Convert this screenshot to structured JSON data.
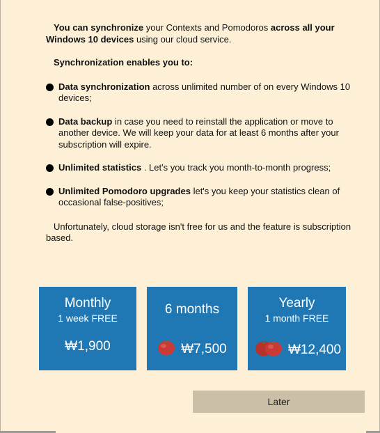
{
  "intro": {
    "bold1": "You can synchronize",
    "rest1": " your Contexts and Pomodoros ",
    "bold2": "across all your Windows 10 devices",
    "rest2": " using our cloud service."
  },
  "enables_heading": "Synchronization enables you to:",
  "bullets": [
    {
      "title": "Data synchronization",
      "desc": " across unlimited number of on every Windows 10 devices;"
    },
    {
      "title": "Data backup",
      "desc": " in case you need to reinstall the application or move to another device. We will keep your data for at least 6 months after your subscription will expire."
    },
    {
      "title": "Unlimited statistics",
      "desc": " . Let's you track you month-to-month progress;"
    },
    {
      "title": "Unlimited Pomodoro upgrades",
      "desc": " let's you keep your statistics clean of occasional false-positives;"
    }
  ],
  "outro": "Unfortunately, cloud storage isn't free for us and the feature is subscription based.",
  "plans": [
    {
      "name": "Monthly",
      "subtitle": "1 week FREE",
      "price": "₩1,900"
    },
    {
      "name": "6 months",
      "subtitle": "",
      "price": "₩7,500"
    },
    {
      "name": "Yearly",
      "subtitle": "1 month FREE",
      "price": "₩12,400"
    }
  ],
  "later_label": "Later",
  "icons": {
    "bullet": "bullet-dot-icon",
    "plan_6m": "tomato-icon",
    "plan_yearly": "tomato-pair-icon"
  },
  "colors": {
    "background": "#fdf0d6",
    "plan_tile": "#1f78b4",
    "later_button": "#cbbfa8"
  }
}
